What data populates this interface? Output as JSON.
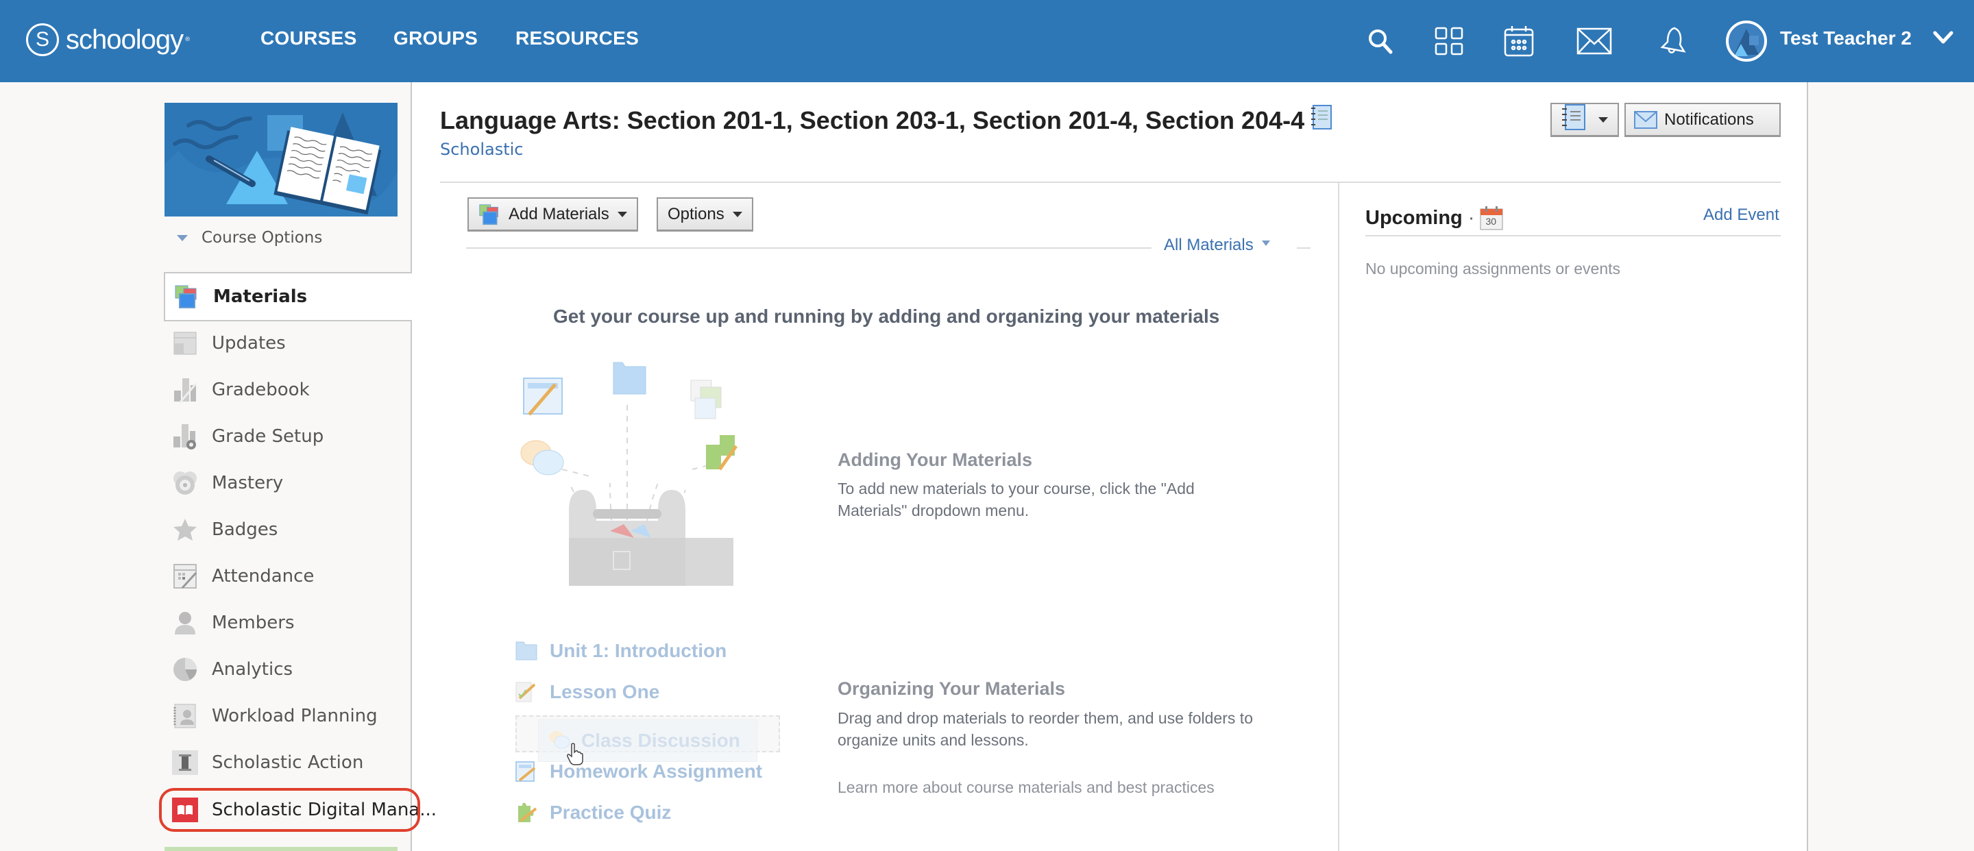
{
  "header": {
    "logo_text": "schoology",
    "logo_mark": "S",
    "nav": [
      "COURSES",
      "GROUPS",
      "RESOURCES"
    ],
    "icons": [
      "search-icon",
      "apps-grid-icon",
      "calendar-icon",
      "mail-icon",
      "bell-icon"
    ],
    "user_name": "Test Teacher 2",
    "brand_color": "#2e77b6"
  },
  "sidebar": {
    "course_options_label": "Course Options",
    "items": [
      {
        "label": "Materials",
        "icon": "materials-icon",
        "active": true
      },
      {
        "label": "Updates",
        "icon": "updates-icon"
      },
      {
        "label": "Gradebook",
        "icon": "gradebook-icon"
      },
      {
        "label": "Grade Setup",
        "icon": "grade-setup-icon"
      },
      {
        "label": "Mastery",
        "icon": "mastery-icon"
      },
      {
        "label": "Badges",
        "icon": "badges-icon"
      },
      {
        "label": "Attendance",
        "icon": "attendance-icon"
      },
      {
        "label": "Members",
        "icon": "members-icon"
      },
      {
        "label": "Analytics",
        "icon": "analytics-icon"
      },
      {
        "label": "Workload Planning",
        "icon": "workload-planning-icon"
      },
      {
        "label": "Scholastic Action",
        "icon": "scholastic-action-icon"
      },
      {
        "label": "Scholastic Digital Mana...",
        "icon": "scholastic-digital-icon",
        "highlighted": true
      }
    ],
    "highlight_color": "#e0412e"
  },
  "course": {
    "title": "Language Arts: Section 201-1, Section 203-1, Section 201-4, Section 204-4",
    "school": "Scholastic"
  },
  "toolbar": {
    "add_materials": "Add Materials",
    "options": "Options",
    "filter": "All Materials",
    "notifications": "Notifications"
  },
  "empty_state": {
    "tagline": "Get your course up and running by adding and organizing your materials",
    "adding_title": "Adding Your Materials",
    "adding_text": "To add new materials to your course, click the \"Add Materials\" dropdown menu.",
    "organizing_title": "Organizing Your Materials",
    "organizing_text": "Drag and drop materials to reorder them, and use folders to organize units and lessons.",
    "learn_more": "Learn more about course materials and best practices",
    "sample_items": [
      {
        "label": "Unit 1: Introduction",
        "icon": "folder-icon"
      },
      {
        "label": "Lesson One",
        "icon": "lesson-icon"
      },
      {
        "label": "Class Discussion",
        "icon": "discussion-icon"
      },
      {
        "label": "Homework Assignment",
        "icon": "assignment-icon"
      },
      {
        "label": "Practice Quiz",
        "icon": "quiz-icon"
      }
    ]
  },
  "upcoming": {
    "title": "Upcoming",
    "separator": "·",
    "calendar_day": "30",
    "add_event": "Add Event",
    "empty": "No upcoming assignments or events"
  }
}
